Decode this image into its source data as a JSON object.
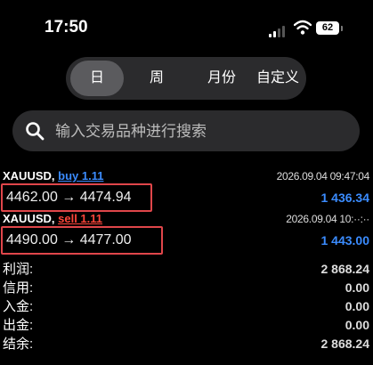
{
  "status": {
    "time": "17:50",
    "battery": "62"
  },
  "period_tabs": [
    {
      "label": "日",
      "active": true
    },
    {
      "label": "周",
      "active": false
    },
    {
      "label": "月份",
      "active": false
    },
    {
      "label": "自定义",
      "active": false
    }
  ],
  "search": {
    "placeholder": "输入交易品种进行搜索"
  },
  "trades": [
    {
      "symbol": "XAUUSD,",
      "side": "buy 1.11",
      "time": "2026.09.04 09:47:04",
      "prices": "4462.00 → 4474.94",
      "profit": "1 436.34"
    },
    {
      "symbol": "XAUUSD,",
      "side": "sell 1.11",
      "time": "2026.09.04 10:··:··",
      "prices": "4490.00 → 4477.00",
      "profit": "1 443.00"
    }
  ],
  "summary": [
    {
      "label": "利润:",
      "value": "2 868.24"
    },
    {
      "label": "信用:",
      "value": "0.00"
    },
    {
      "label": "入金:",
      "value": "0.00"
    },
    {
      "label": "出金:",
      "value": "0.00"
    },
    {
      "label": "结余:",
      "value": "2 868.24"
    }
  ],
  "colors": {
    "buy": "#3b8cff",
    "sell": "#ff453a",
    "highlight_box": "#e0464a"
  }
}
